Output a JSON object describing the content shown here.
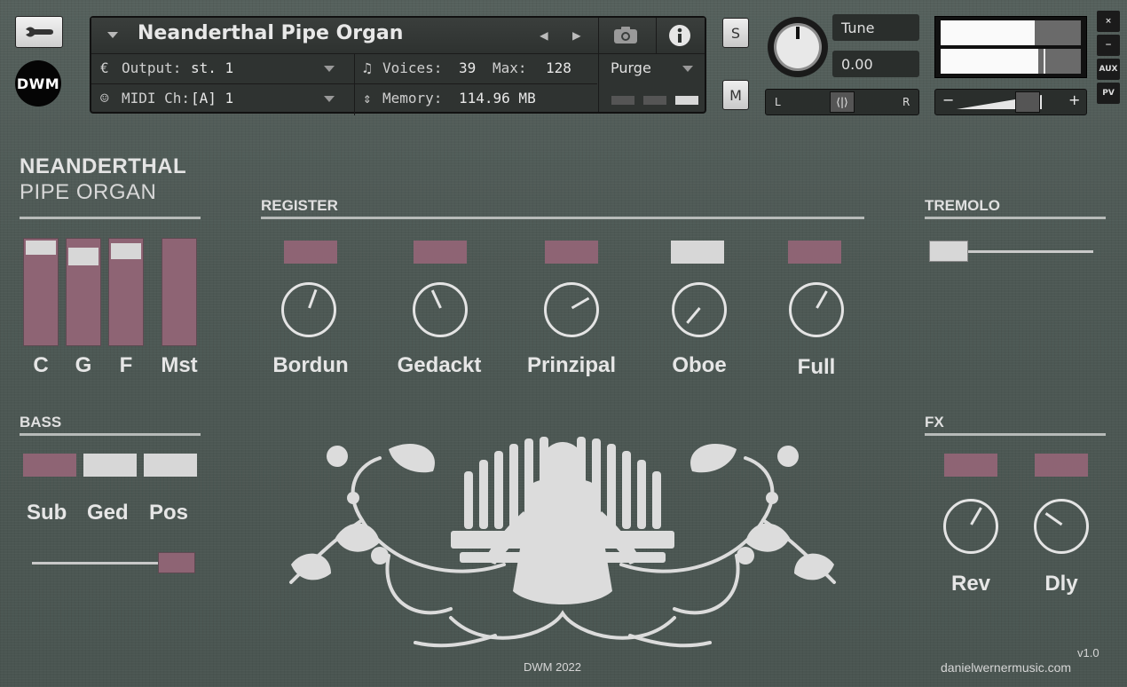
{
  "header": {
    "instrument_name": "Neanderthal Pipe Organ",
    "output_label": "Output:",
    "output_value": "st. 1",
    "midi_label": "MIDI Ch:",
    "midi_value": "[A]  1",
    "voices_label": "Voices:",
    "voices_value": "39",
    "max_label": "Max:",
    "max_value": "128",
    "memory_label": "Memory:",
    "memory_value": "114.96 MB",
    "purge_label": "Purge",
    "solo_label": "S",
    "mute_label": "M",
    "tune_label": "Tune",
    "tune_value": "0.00",
    "pan_left": "L",
    "pan_right": "R",
    "vol_minus": "−",
    "vol_plus": "+",
    "side_buttons": [
      "×",
      "−",
      "AUX",
      "PV"
    ],
    "logo_text": "DWM"
  },
  "panel": {
    "title_line1": "NEANDERTHAL",
    "title_line2": "PIPE ORGAN",
    "faders": [
      {
        "label": "C",
        "level": 0.93
      },
      {
        "label": "G",
        "level": 0.86
      },
      {
        "label": "F",
        "level": 0.89
      },
      {
        "label": "Mst",
        "level": 1.0
      }
    ],
    "register": {
      "heading": "REGISTER",
      "stops": [
        {
          "label": "Bordun",
          "active": true,
          "knob_deg": 20
        },
        {
          "label": "Gedackt",
          "active": true,
          "knob_deg": -25
        },
        {
          "label": "Prinzipal",
          "active": true,
          "knob_deg": 60
        },
        {
          "label": "Oboe",
          "active": false,
          "knob_deg": -140
        },
        {
          "label": "Full",
          "active": true,
          "knob_deg": 30
        }
      ]
    },
    "tremolo": {
      "heading": "TREMOLO",
      "value": 0.0
    },
    "bass": {
      "heading": "BASS",
      "buttons": [
        {
          "label": "Sub",
          "active": true
        },
        {
          "label": "Ged",
          "active": false
        },
        {
          "label": "Pos",
          "active": false
        }
      ],
      "slider_value": 1.0
    },
    "fx": {
      "heading": "FX",
      "units": [
        {
          "label": "Rev",
          "active": true,
          "knob_deg": 30
        },
        {
          "label": "Dly",
          "active": true,
          "knob_deg": -55
        }
      ]
    },
    "footer": {
      "credit": "DWM 2022",
      "version": "v1.0",
      "website": "danielwernermusic.com"
    }
  },
  "colors": {
    "background": "#4d5854",
    "active_button": "#8e6474",
    "inactive_button": "#d7d7d7",
    "knob_stroke": "#e4e4e4"
  }
}
